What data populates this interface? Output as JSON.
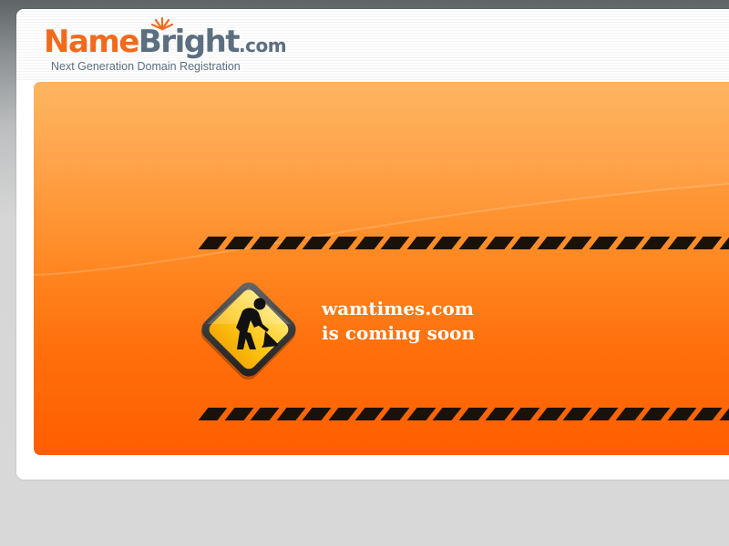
{
  "brand": {
    "name_part1": "Name",
    "name_part2": "Bright",
    "tld": ".com",
    "tagline": "Next Generation Domain Registration",
    "colors": {
      "orange": "#f26a1b",
      "slate": "#5c6f80"
    }
  },
  "notice": {
    "domain": "wamtimes.com",
    "status": "is coming soon",
    "icon": "construction-worker-sign-icon"
  },
  "theme": {
    "panel_top": "#ffad4f",
    "panel_bottom": "#ff5e00",
    "stripe_color": "#1a1208"
  }
}
